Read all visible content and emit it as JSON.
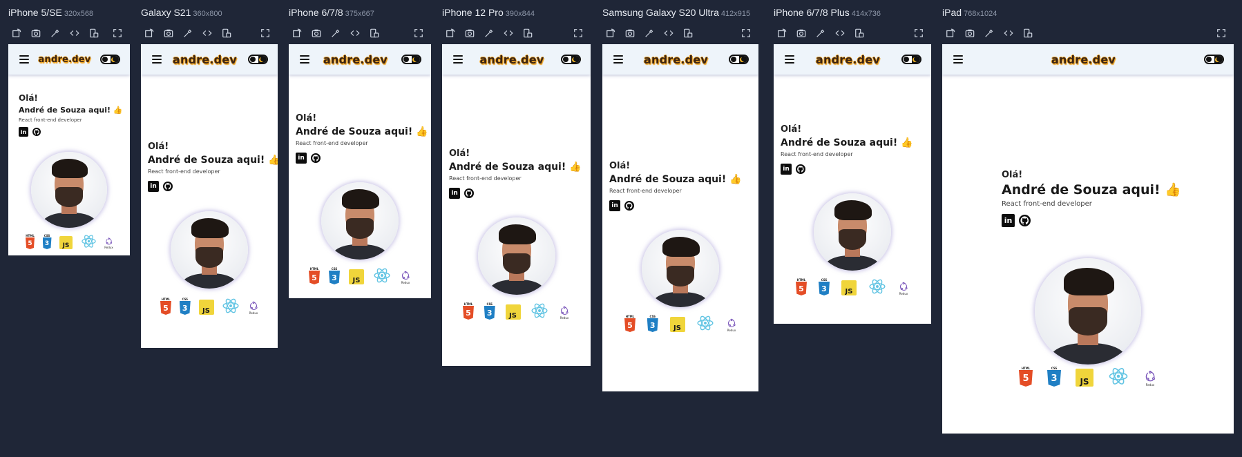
{
  "devices": [
    {
      "name": "iPhone 5/SE",
      "size": "320x568"
    },
    {
      "name": "Galaxy S21",
      "size": "360x800"
    },
    {
      "name": "iPhone 6/7/8",
      "size": "375x667"
    },
    {
      "name": "iPhone 12 Pro",
      "size": "390x844"
    },
    {
      "name": "Samsung Galaxy S20 Ultra",
      "size": "412x915"
    },
    {
      "name": "iPhone 6/7/8 Plus",
      "size": "414x736"
    },
    {
      "name": "iPad",
      "size": "768x1024"
    }
  ],
  "toolbar_icons": [
    "rotate-icon",
    "camera-icon",
    "eyedropper-icon",
    "code-icon",
    "device-swap-icon",
    "fullscreen-icon"
  ],
  "site": {
    "brand": "andre.dev",
    "greeting": "Olá!",
    "name": "André de Souza aqui!",
    "thumb": "👍",
    "role": "React front-end developer",
    "linkedin": "in",
    "techs": [
      {
        "name": "html5",
        "caption": "HTML",
        "glyph": "5"
      },
      {
        "name": "css3",
        "caption": "CSS",
        "glyph": "3"
      },
      {
        "name": "javascript",
        "glyph": "JS"
      },
      {
        "name": "react"
      },
      {
        "name": "redux",
        "caption": "Redux"
      }
    ]
  },
  "colors": {
    "background": "#1f2637",
    "navbar": "#eef4fa",
    "brand_outline": "#f0a626",
    "brand_text": "#3b2414",
    "thumb": "#f2b33d"
  }
}
